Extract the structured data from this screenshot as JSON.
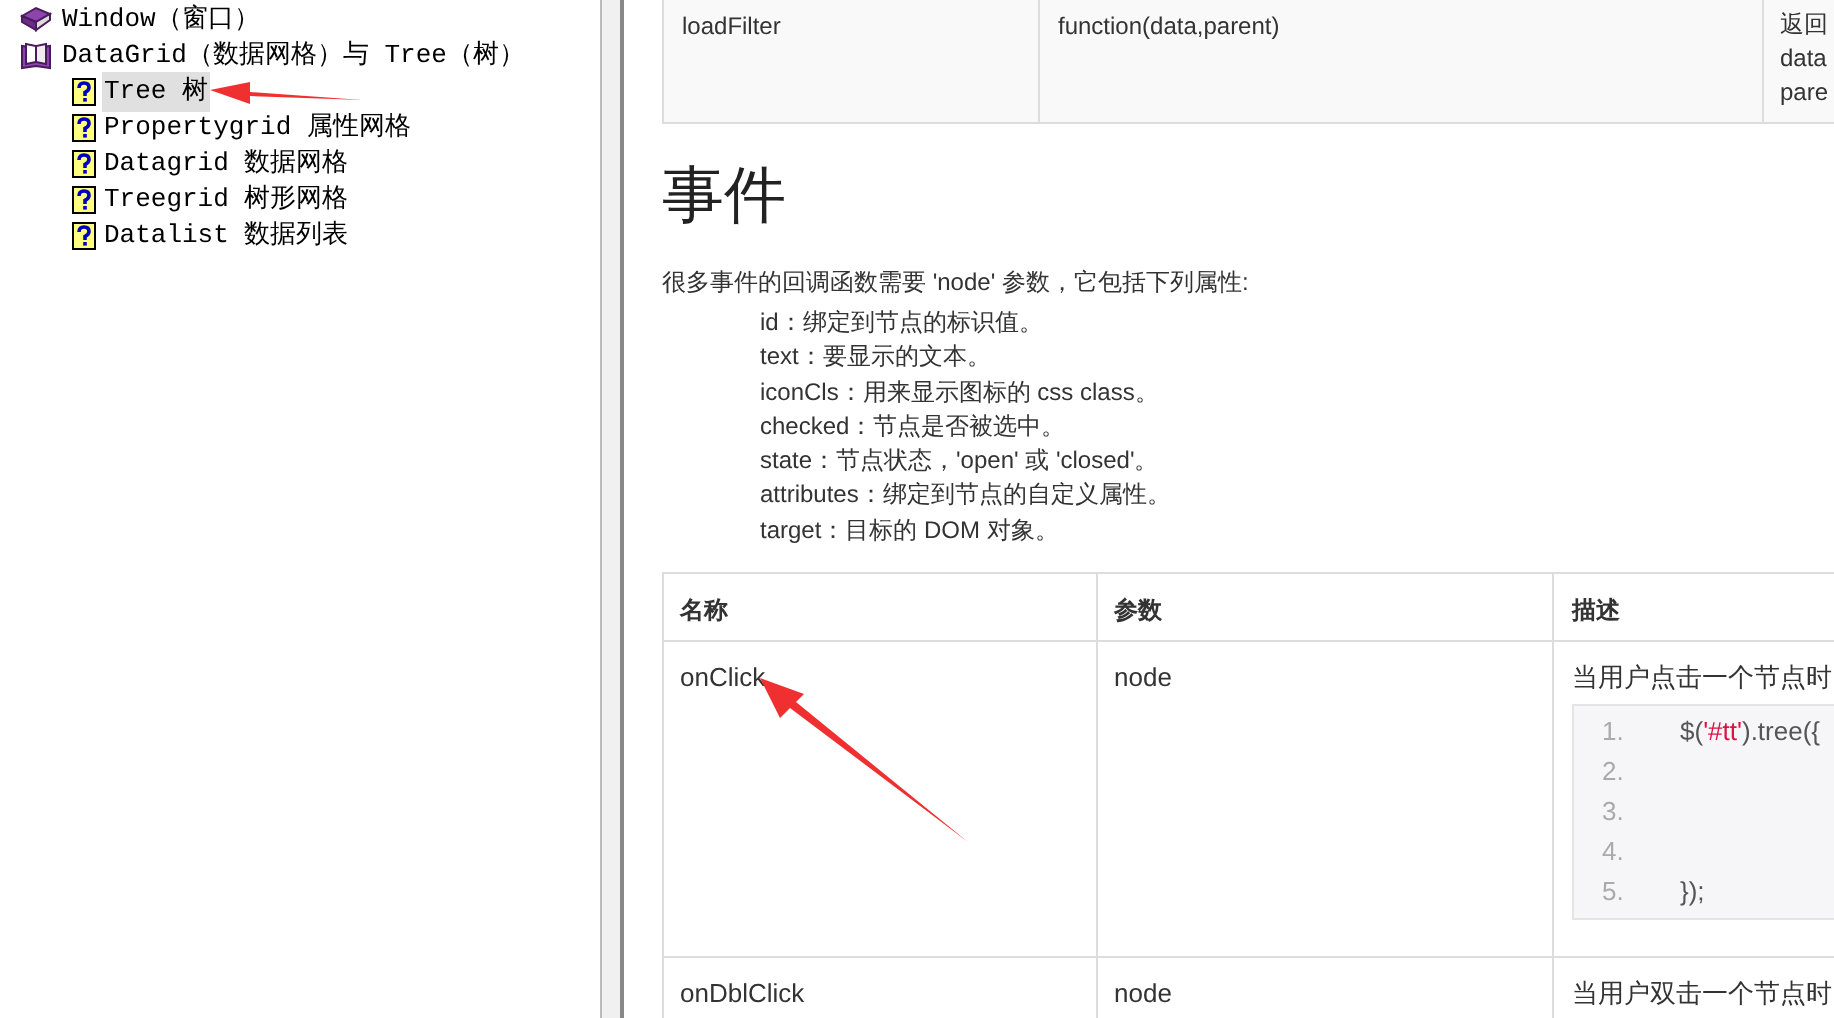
{
  "tree": {
    "items": [
      {
        "label": "Window（窗口）",
        "kind": "book",
        "selected": false
      },
      {
        "label": "DataGrid（数据网格）与 Tree（树）",
        "kind": "book-open",
        "selected": false,
        "children": [
          {
            "label": "Tree 树",
            "kind": "help",
            "selected": true
          },
          {
            "label": "Propertygrid 属性网格",
            "kind": "help",
            "selected": false
          },
          {
            "label": "Datagrid 数据网格",
            "kind": "help",
            "selected": false
          },
          {
            "label": "Treegrid 树形网格",
            "kind": "help",
            "selected": false
          },
          {
            "label": "Datalist 数据列表",
            "kind": "help",
            "selected": false
          }
        ]
      }
    ]
  },
  "top_table": {
    "rows": [
      {
        "name": "loadFilter",
        "param": "function(data,parent)",
        "description": [
          "返回",
          "data",
          "pare"
        ]
      }
    ]
  },
  "heading": "事件",
  "intro": "很多事件的回调函数需要 'node' 参数，它包括下列属性:",
  "properties": [
    "id：绑定到节点的标识值。",
    "text：要显示的文本。",
    "iconCls：用来显示图标的 css class。",
    "checked：节点是否被选中。",
    "state：节点状态，'open' 或 'closed'。",
    "attributes：绑定到节点的自定义属性。",
    "target：目标的 DOM 对象。"
  ],
  "events_table": {
    "columns": [
      "名称",
      "参数",
      "描述"
    ],
    "rows": [
      {
        "name": "onClick",
        "param": "node",
        "description": "当用户点击一个节点时",
        "code": [
          {
            "number": "1.",
            "segments": [
              {
                "text": "$(",
                "kind": "plain"
              },
              {
                "text": "'#tt'",
                "kind": "string"
              },
              {
                "text": ").tree({",
                "kind": "plain"
              }
            ]
          },
          {
            "number": "2."
          },
          {
            "number": "3."
          },
          {
            "number": "4."
          },
          {
            "number": "5.",
            "segments": [
              {
                "text": "});",
                "kind": "plain"
              }
            ]
          }
        ]
      },
      {
        "name": "onDblClick",
        "param": "node",
        "description": "当用户双击一个节点时",
        "code": []
      }
    ]
  }
}
